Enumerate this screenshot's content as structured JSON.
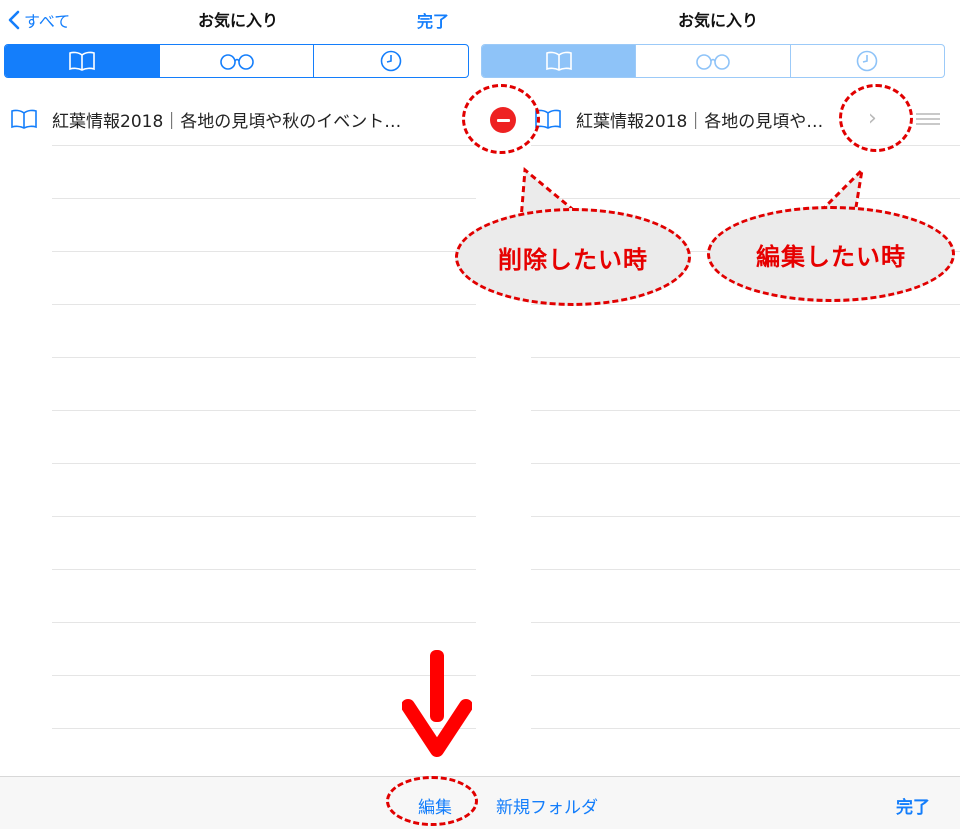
{
  "left_pane": {
    "nav": {
      "back_label": "すべて",
      "title": "お気に入り",
      "done_label": "完了"
    },
    "segments": [
      {
        "icon": "bookmarks-icon",
        "selected": true
      },
      {
        "icon": "reading-list-icon",
        "selected": false
      },
      {
        "icon": "history-icon",
        "selected": false
      }
    ],
    "favorite_item": {
      "icon": "bookmark-icon",
      "title": "紅葉情報2018｜各地の見頃や秋のイベント…"
    }
  },
  "right_pane": {
    "nav": {
      "title": "お気に入り"
    },
    "segments": [
      {
        "icon": "bookmarks-icon",
        "selected": true
      },
      {
        "icon": "reading-list-icon",
        "selected": false
      },
      {
        "icon": "history-icon",
        "selected": false
      }
    ],
    "favorite_item": {
      "icon": "bookmark-icon",
      "title": "紅葉情報2018｜各地の見頃や…"
    }
  },
  "toolbar": {
    "edit_label": "編集",
    "new_folder_label": "新規フォルダ",
    "done_label": "完了"
  },
  "annotations": {
    "delete_label": "削除したい時",
    "edit_label": "編集したい時"
  },
  "colors": {
    "accent": "#147efb",
    "delete": "#ee2222",
    "annotation": "#e10000"
  }
}
